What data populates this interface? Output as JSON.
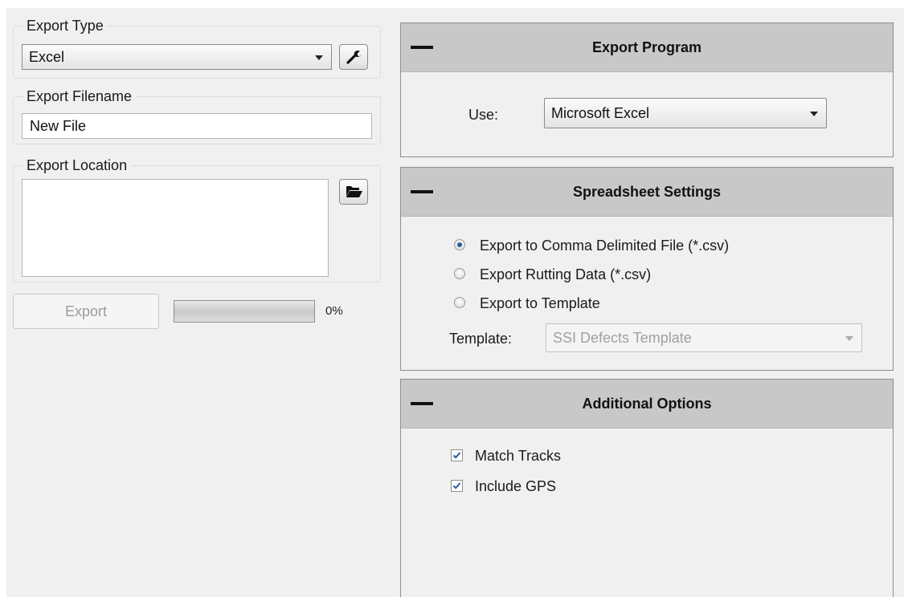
{
  "left": {
    "export_type": {
      "label": "Export Type",
      "value": "Excel"
    },
    "export_filename": {
      "label": "Export Filename",
      "value": "New File"
    },
    "export_location": {
      "label": "Export Location",
      "value": ""
    },
    "export_button": "Export",
    "progress": {
      "percent": 0,
      "text": "0%",
      "fill_color": "#33a853"
    }
  },
  "panels": {
    "program": {
      "title": "Export Program",
      "use_label": "Use:",
      "use_value": "Microsoft Excel"
    },
    "spreadsheet": {
      "title": "Spreadsheet Settings",
      "options": [
        {
          "label": "Export to Comma Delimited File (*.csv)",
          "selected": true
        },
        {
          "label": "Export Rutting Data (*.csv)",
          "selected": false
        },
        {
          "label": "Export to Template",
          "selected": false
        }
      ],
      "template_label": "Template:",
      "template_value": "SSI Defects Template"
    },
    "additional": {
      "title": "Additional Options",
      "checks": [
        {
          "label": "Match Tracks",
          "checked": true
        },
        {
          "label": "Include GPS",
          "checked": true
        }
      ]
    }
  },
  "icons": {
    "type_settings": "wrench-icon",
    "browse_location": "folder-open-icon",
    "collapse": "minus-icon",
    "dropdown": "chevron-down-icon",
    "check_mark": "check-icon"
  },
  "colors": {
    "panel_header": "#c8c8c8",
    "radio_selected": "#2c5aa0",
    "check_mark": "#2c5aa0"
  }
}
